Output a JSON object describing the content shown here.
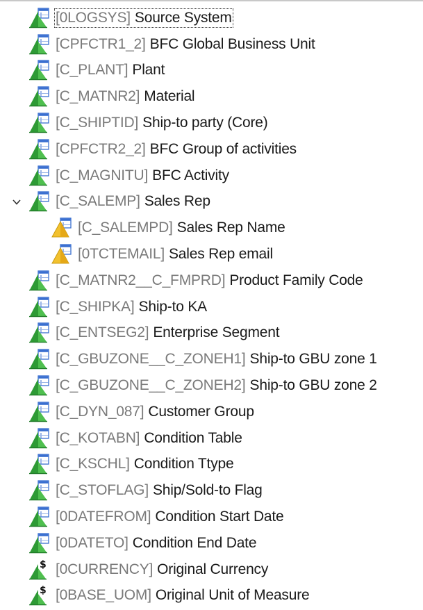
{
  "colors": {
    "icon_green": "#2e9a35",
    "icon_blue": "#3a6fd0",
    "icon_warning_yellow": "#f2c12e",
    "tech_name_gray": "#7a7a7a",
    "text": "#1a1a1a"
  },
  "tree": {
    "items": [
      {
        "tech": "[0LOGSYS]",
        "desc": "Source System",
        "icon": "characteristic-icon",
        "level": 0,
        "focused": true
      },
      {
        "tech": "[CPFCTR1_2]",
        "desc": "BFC Global Business Unit",
        "icon": "characteristic-icon",
        "level": 0
      },
      {
        "tech": "[C_PLANT]",
        "desc": "Plant",
        "icon": "characteristic-icon",
        "level": 0
      },
      {
        "tech": "[C_MATNR2]",
        "desc": "Material",
        "icon": "characteristic-icon",
        "level": 0
      },
      {
        "tech": "[C_SHIPTID]",
        "desc": "Ship-to party (Core)",
        "icon": "characteristic-icon",
        "level": 0
      },
      {
        "tech": "[CPFCTR2_2]",
        "desc": "BFC Group of activities",
        "icon": "characteristic-icon",
        "level": 0
      },
      {
        "tech": "[C_MAGNITU]",
        "desc": "BFC Activity",
        "icon": "characteristic-icon",
        "level": 0
      },
      {
        "tech": "[C_SALEMP]",
        "desc": "Sales Rep",
        "icon": "characteristic-icon",
        "level": 0,
        "expanded": true
      },
      {
        "tech": "[C_SALEMPD]",
        "desc": "Sales Rep Name",
        "icon": "attribute-warning-icon",
        "level": 1
      },
      {
        "tech": "[0TCTEMAIL]",
        "desc": "Sales Rep email",
        "icon": "attribute-warning-icon",
        "level": 1
      },
      {
        "tech": "[C_MATNR2__C_FMPRD]",
        "desc": "Product Family Code",
        "icon": "characteristic-icon",
        "level": 0
      },
      {
        "tech": "[C_SHIPKA]",
        "desc": "Ship-to KA",
        "icon": "characteristic-icon",
        "level": 0
      },
      {
        "tech": "[C_ENTSEG2]",
        "desc": "Enterprise Segment",
        "icon": "characteristic-icon",
        "level": 0
      },
      {
        "tech": "[C_GBUZONE__C_ZONEH1]",
        "desc": "Ship-to GBU zone 1",
        "icon": "characteristic-icon",
        "level": 0
      },
      {
        "tech": "[C_GBUZONE__C_ZONEH2]",
        "desc": "Ship-to GBU zone 2",
        "icon": "characteristic-icon",
        "level": 0
      },
      {
        "tech": "[C_DYN_087]",
        "desc": "Customer Group",
        "icon": "characteristic-icon",
        "level": 0
      },
      {
        "tech": "[C_KOTABN]",
        "desc": "Condition Table",
        "icon": "characteristic-icon",
        "level": 0
      },
      {
        "tech": "[C_KSCHL]",
        "desc": "Condition Ttype",
        "icon": "characteristic-icon",
        "level": 0
      },
      {
        "tech": "[C_STOFLAG]",
        "desc": "Ship/Sold-to Flag",
        "icon": "characteristic-icon",
        "level": 0
      },
      {
        "tech": "[0DATEFROM]",
        "desc": "Condition Start Date",
        "icon": "characteristic-icon",
        "level": 0
      },
      {
        "tech": "[0DATETO]",
        "desc": "Condition End Date",
        "icon": "characteristic-icon",
        "level": 0
      },
      {
        "tech": "[0CURRENCY]",
        "desc": "Original Currency",
        "icon": "currency-icon",
        "level": 0
      },
      {
        "tech": "[0BASE_UOM]",
        "desc": "Original Unit of Measure",
        "icon": "currency-icon",
        "level": 0
      }
    ]
  }
}
